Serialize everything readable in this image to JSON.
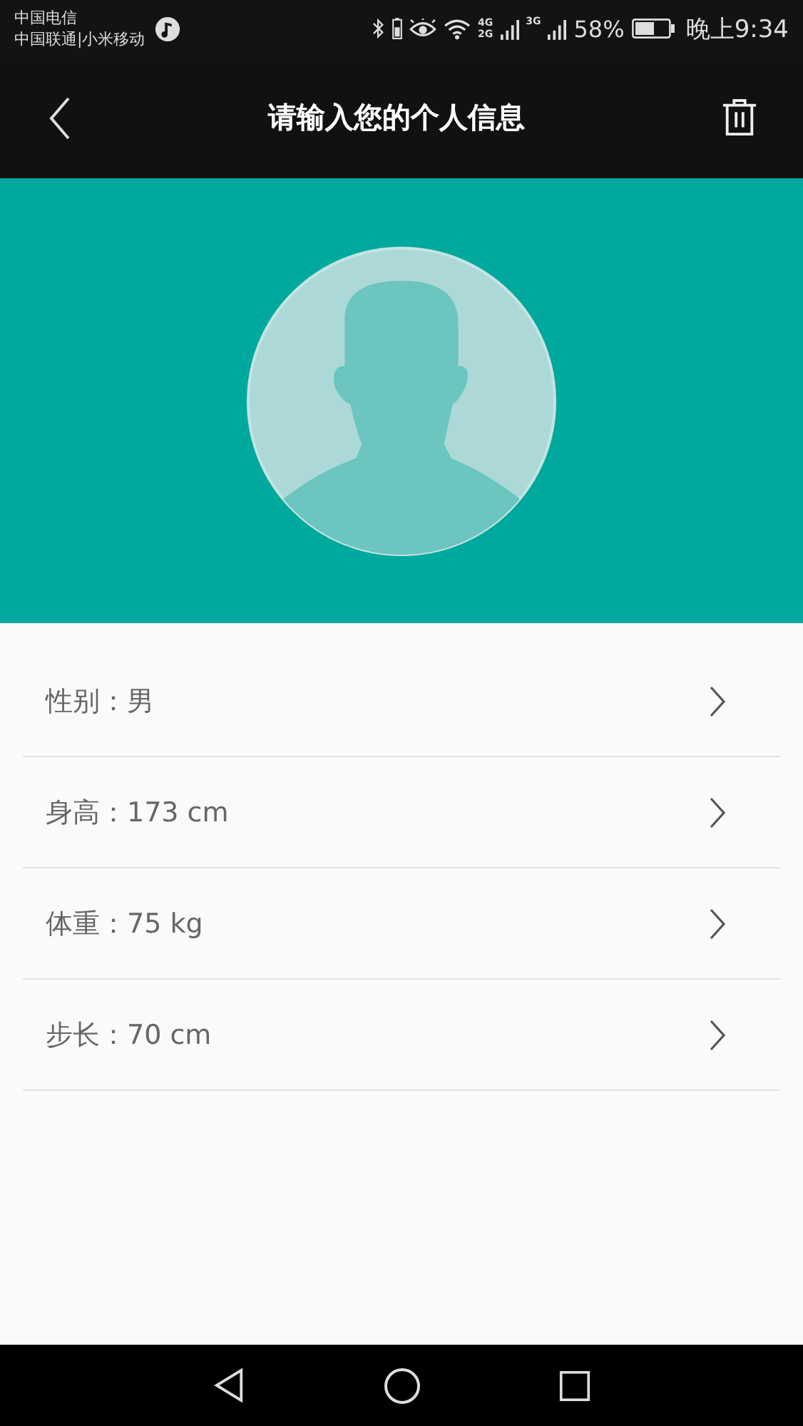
{
  "status_bar": {
    "carriers": [
      "中国电信",
      "中国联通|小米移动"
    ],
    "network_labels": [
      "4G",
      "2G",
      "3G"
    ],
    "battery_percent": "58%",
    "time": "晚上9:34"
  },
  "header": {
    "title": "请输入您的个人信息"
  },
  "rows": [
    {
      "label": "性别：男"
    },
    {
      "label": "身高：173 cm"
    },
    {
      "label": "体重：75 kg"
    },
    {
      "label": "步长：70 cm"
    }
  ]
}
